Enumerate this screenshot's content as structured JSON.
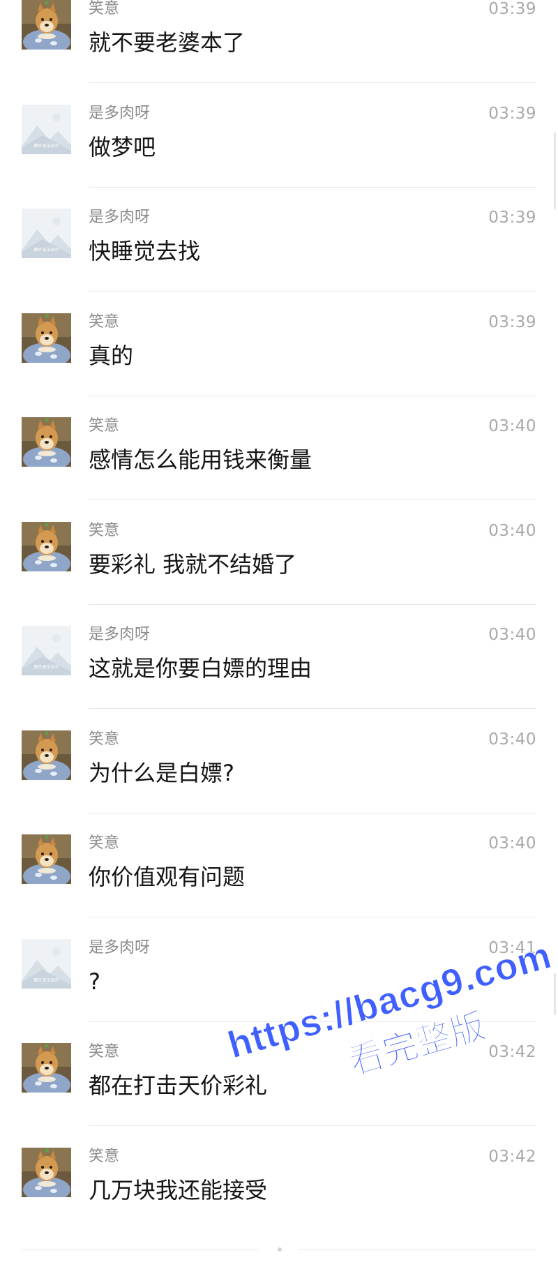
{
  "messages": [
    {
      "sender": "笑意",
      "time": "03:39",
      "text": "就不要老婆本了",
      "avatar": "dog-avatar"
    },
    {
      "sender": "是多肉呀",
      "time": "03:39",
      "text": "做梦吧",
      "avatar": "placeholder-avatar"
    },
    {
      "sender": "是多肉呀",
      "time": "03:39",
      "text": "快睡觉去找",
      "avatar": "placeholder-avatar"
    },
    {
      "sender": "笑意",
      "time": "03:39",
      "text": "真的",
      "avatar": "dog-avatar"
    },
    {
      "sender": "笑意",
      "time": "03:40",
      "text": "感情怎么能用钱来衡量",
      "avatar": "dog-avatar"
    },
    {
      "sender": "笑意",
      "time": "03:40",
      "text": "要彩礼 我就不结婚了",
      "avatar": "dog-avatar"
    },
    {
      "sender": "是多肉呀",
      "time": "03:40",
      "text": "这就是你要白嫖的理由",
      "avatar": "placeholder-avatar"
    },
    {
      "sender": "笑意",
      "time": "03:40",
      "text": "为什么是白嫖?",
      "avatar": "dog-avatar"
    },
    {
      "sender": "笑意",
      "time": "03:40",
      "text": "你价值观有问题",
      "avatar": "dog-avatar"
    },
    {
      "sender": "是多肉呀",
      "time": "03:41",
      "text": "?",
      "avatar": "placeholder-avatar"
    },
    {
      "sender": "笑意",
      "time": "03:42",
      "text": "都在打击天价彩礼",
      "avatar": "dog-avatar"
    },
    {
      "sender": "笑意",
      "time": "03:42",
      "text": "几万块我还能接受",
      "avatar": "dog-avatar"
    }
  ],
  "placeholder_avatar_caption": "图片无法显示",
  "watermark": {
    "url": "https://bacg9.com",
    "subtitle": "看完整版",
    "color": "#3f5fff"
  },
  "colors": {
    "sender": "#8a8a8a",
    "time": "#a9a9a9",
    "text": "#151515",
    "divider": "#e8e8e8"
  }
}
